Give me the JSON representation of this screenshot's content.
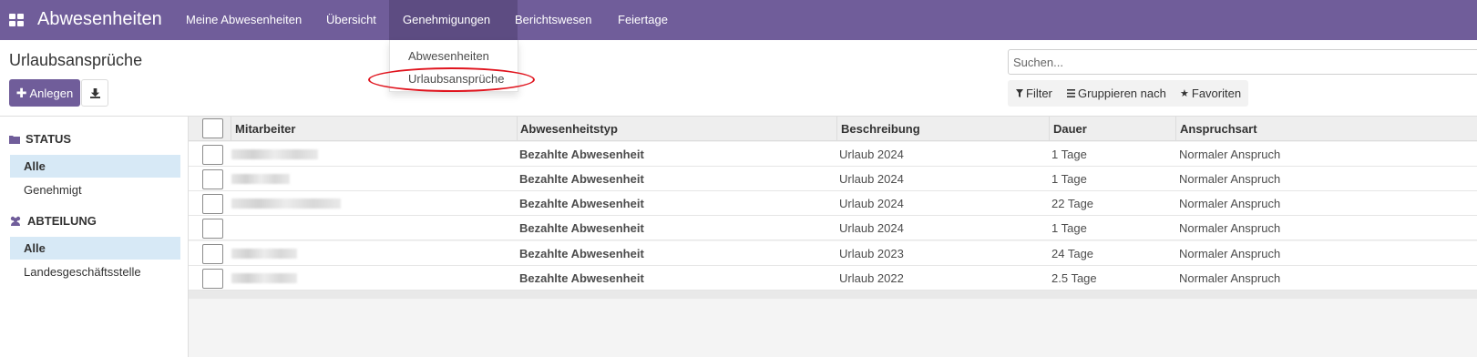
{
  "app": {
    "title": "Abwesenheiten",
    "icon": "apps-grid-icon",
    "brand_color": "#705d9a"
  },
  "nav": {
    "items": [
      "Meine Abwesenheiten",
      "Übersicht",
      "Genehmigungen",
      "Berichtswesen",
      "Feiertage"
    ],
    "active": "Genehmigungen"
  },
  "dropdown": {
    "items": [
      "Abwesenheiten",
      "Urlaubsansprüche"
    ],
    "highlighted": "Urlaubsansprüche",
    "highlight_color": "#e0141e"
  },
  "page": {
    "title": "Urlaubsansprüche",
    "create_label": "Anlegen",
    "create_icon": "plus-icon",
    "download_icon": "download-icon"
  },
  "search": {
    "placeholder": "Suchen...",
    "filter_label": "Filter",
    "group_label": "Gruppieren nach",
    "favorites_label": "Favoriten"
  },
  "sidebar": {
    "status_heading": "STATUS",
    "status_items": [
      "Alle",
      "Genehmigt"
    ],
    "department_heading": "ABTEILUNG",
    "department_items": [
      "Alle",
      "Landesgeschäftsstelle"
    ],
    "active_color": "#d7e9f6"
  },
  "table": {
    "columns": [
      "Mitarbeiter",
      "Abwesenheitstyp",
      "Beschreibung",
      "Dauer",
      "Anspruchsart"
    ],
    "rows": [
      {
        "type": "Bezahlte Abwesenheit",
        "description": "Urlaub 2024",
        "duration": "1 Tage",
        "kind": "Normaler Anspruch"
      },
      {
        "type": "Bezahlte Abwesenheit",
        "description": "Urlaub 2024",
        "duration": "1 Tage",
        "kind": "Normaler Anspruch"
      },
      {
        "type": "Bezahlte Abwesenheit",
        "description": "Urlaub 2024",
        "duration": "22 Tage",
        "kind": "Normaler Anspruch"
      },
      {
        "type": "Bezahlte Abwesenheit",
        "description": "Urlaub 2024",
        "duration": "1 Tage",
        "kind": "Normaler Anspruch"
      },
      {
        "type": "Bezahlte Abwesenheit",
        "description": "Urlaub 2023",
        "duration": "24 Tage",
        "kind": "Normaler Anspruch"
      },
      {
        "type": "Bezahlte Abwesenheit",
        "description": "Urlaub 2022",
        "duration": "2.5 Tage",
        "kind": "Normaler Anspruch"
      }
    ]
  }
}
